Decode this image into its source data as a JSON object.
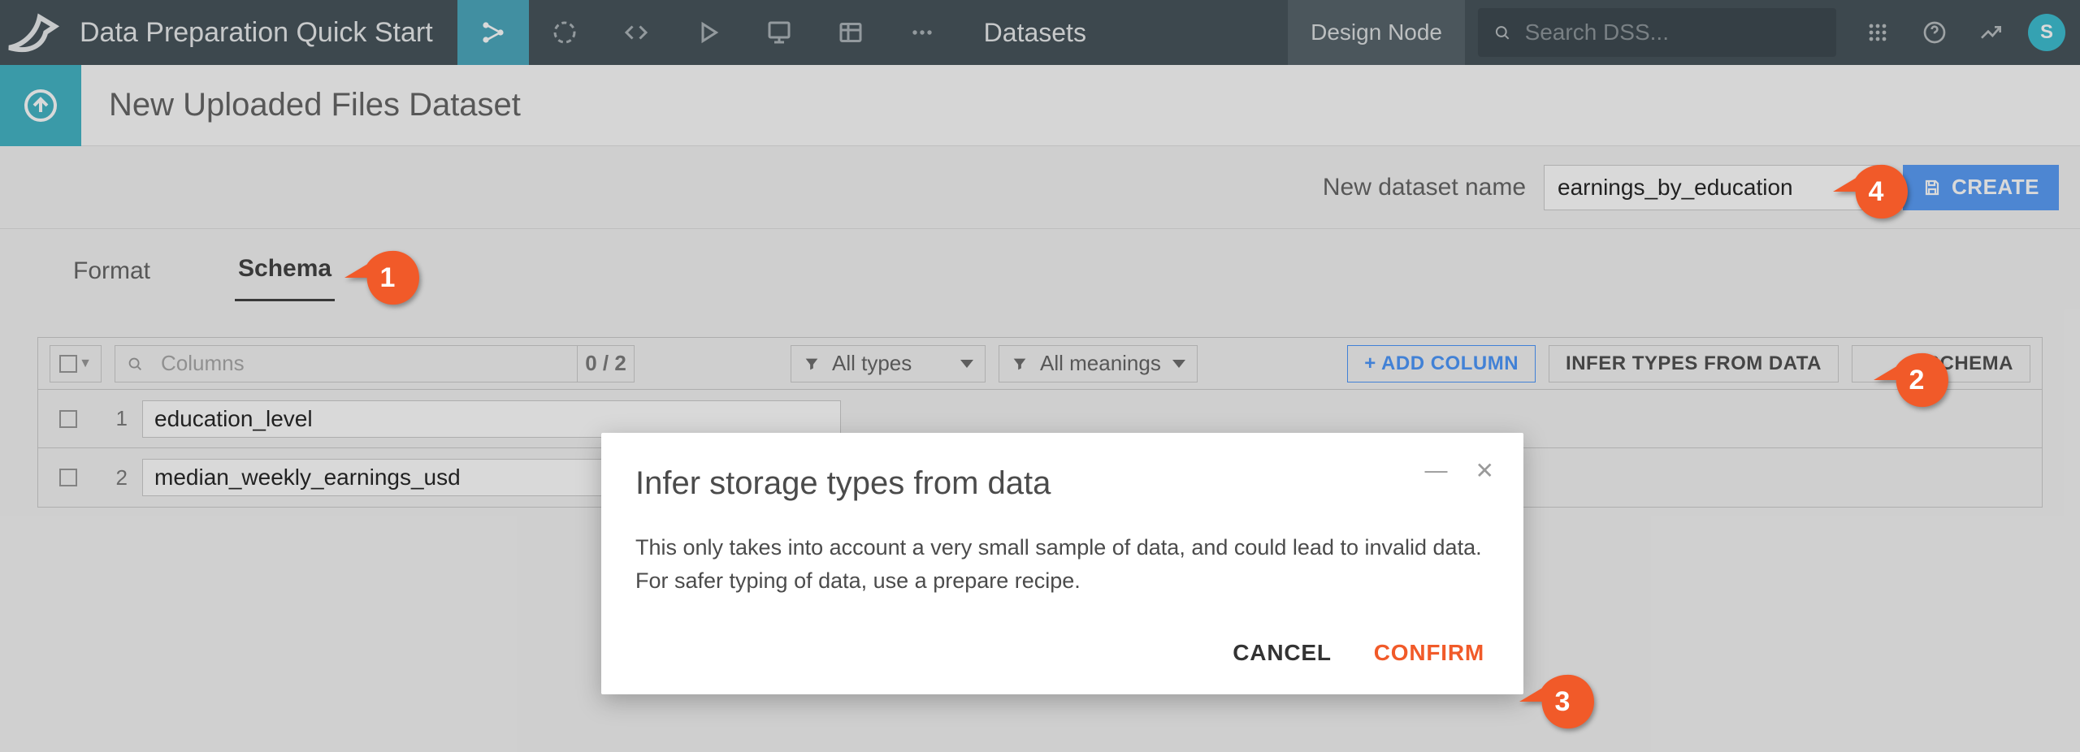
{
  "top": {
    "project_title": "Data Preparation Quick Start",
    "nav_link": "Datasets",
    "design_label": "Design Node",
    "search_placeholder": "Search DSS...",
    "avatar_letter": "S"
  },
  "subheader": {
    "title": "New Uploaded Files Dataset"
  },
  "create": {
    "label": "New dataset name",
    "value": "earnings_by_education",
    "button": "CREATE"
  },
  "tabs": {
    "format": "Format",
    "schema": "Schema"
  },
  "toolbar": {
    "search_placeholder": "Columns",
    "count": "0 / 2",
    "types_label": "All types",
    "meanings_label": "All meanings",
    "add_column": "+ ADD COLUMN",
    "infer": "INFER TYPES FROM DATA",
    "schema": "SCHEMA"
  },
  "rows": [
    {
      "idx": "1",
      "name": "education_level"
    },
    {
      "idx": "2",
      "name": "median_weekly_earnings_usd"
    }
  ],
  "modal": {
    "title": "Infer storage types from data",
    "body": "This only takes into account a very small sample of data, and could lead to invalid data. For safer typing of data, use a prepare recipe.",
    "cancel": "CANCEL",
    "confirm": "CONFIRM"
  },
  "markers": {
    "m1": "1",
    "m2": "2",
    "m3": "3",
    "m4": "4"
  }
}
